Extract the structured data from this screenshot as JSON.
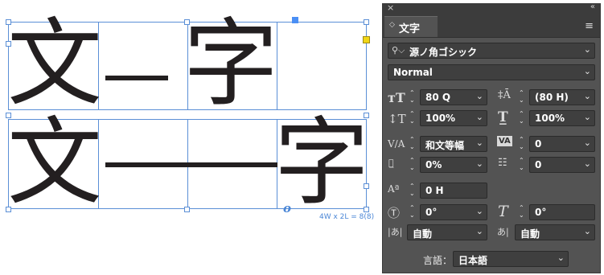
{
  "canvas": {
    "row1": {
      "glyph_left": "文",
      "glyph_right": "字"
    },
    "row2": {
      "glyph_left": "文",
      "glyph_right": "字"
    },
    "grid_info": "4W x 2L = 8(8)",
    "overflow_marker": "o"
  },
  "panel": {
    "close_icon": "×",
    "collapse_icon": "«",
    "tab_label": "文字",
    "font_family": "源ノ角ゴシック",
    "font_style": "Normal",
    "font_size": "80 Q",
    "leading": "(80 H)",
    "vertical_scale": "100%",
    "horizontal_scale": "100%",
    "kerning": "和文等幅",
    "tracking": "0",
    "tsume": "0%",
    "grid_alignment": "0",
    "baseline_shift": "0 H",
    "char_rotation": "0°",
    "skew": "0°",
    "aki_before": "自動",
    "aki_after": "自動",
    "language_label": "言語：",
    "language": "日本語"
  },
  "colors": {
    "frame_stroke": "#5b8fd6",
    "glyph": "#231f20",
    "panel_bg": "#535353",
    "field_bg": "#3f3f3f"
  }
}
